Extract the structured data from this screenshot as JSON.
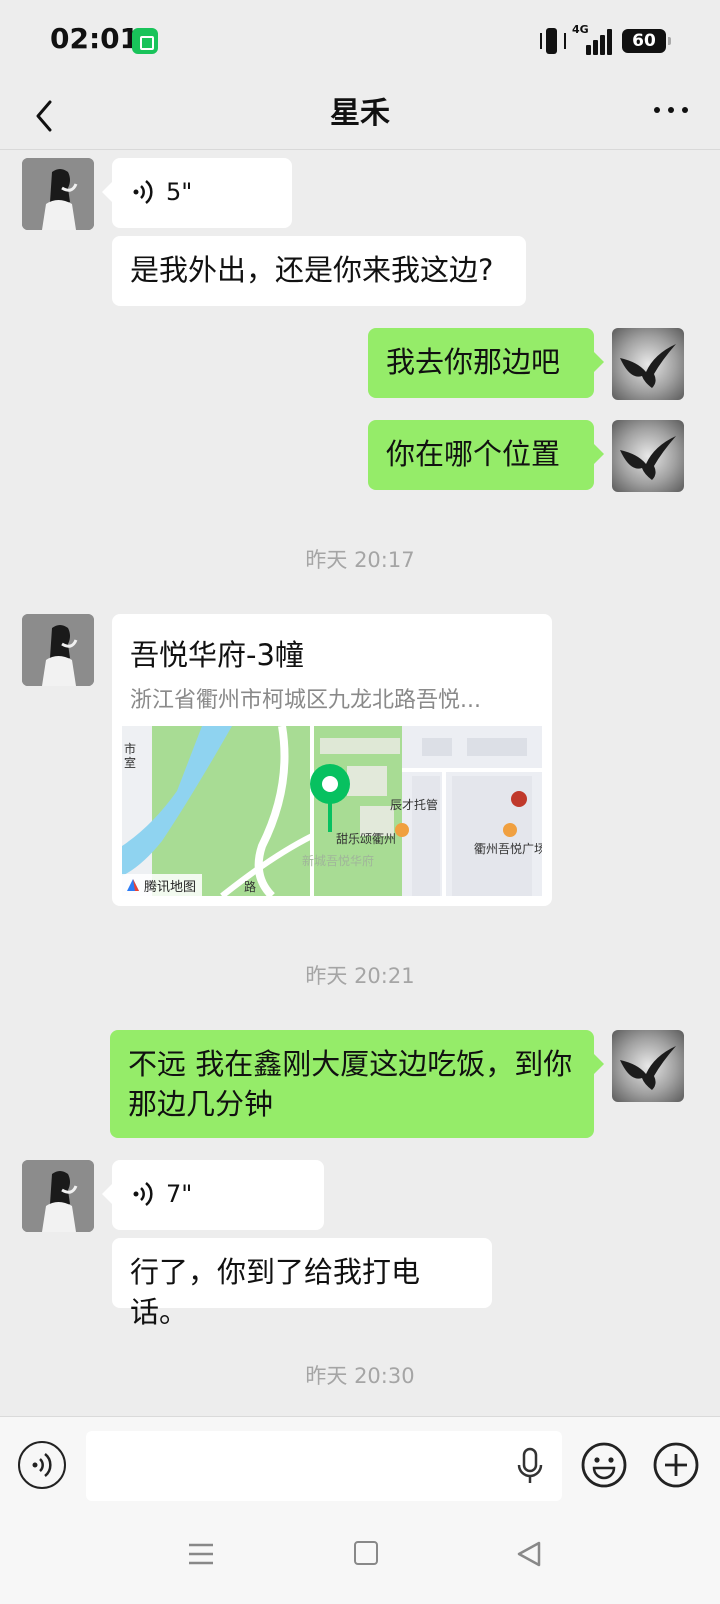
{
  "status_bar": {
    "time": "02:01",
    "network": "4G",
    "battery": "60"
  },
  "header": {
    "title": "星禾"
  },
  "messages": [
    {
      "id": "m1",
      "side": "in",
      "kind": "voice",
      "duration": "5\""
    },
    {
      "id": "m2",
      "side": "in",
      "kind": "text",
      "text": "是我外出，还是你来我这边?"
    },
    {
      "id": "m3",
      "side": "out",
      "kind": "text",
      "text": "我去你那边吧"
    },
    {
      "id": "m4",
      "side": "out",
      "kind": "text",
      "text": "你在哪个位置"
    },
    {
      "id": "t1",
      "kind": "timestamp",
      "text": "昨天 20:17"
    },
    {
      "id": "m5",
      "side": "in",
      "kind": "location",
      "name": "吾悦华府-3幢",
      "address": "浙江省衢州市柯城区九龙北路吾悦...",
      "map_labels": [
        "市",
        "室",
        "辰才托管",
        "甜乐颂衢州",
        "新城吾悦华府",
        "衢州吾悦广场",
        "路"
      ],
      "map_brand": "腾讯地图"
    },
    {
      "id": "t2",
      "kind": "timestamp",
      "text": "昨天 20:21"
    },
    {
      "id": "m6",
      "side": "out",
      "kind": "text",
      "text": "不远 我在鑫刚大厦这边吃饭，到你那边几分钟"
    },
    {
      "id": "m7",
      "side": "in",
      "kind": "voice",
      "duration": "7\""
    },
    {
      "id": "m8",
      "side": "in",
      "kind": "text",
      "text": "行了，你到了给我打电话。"
    },
    {
      "id": "t3",
      "kind": "timestamp",
      "text": "昨天 20:30"
    }
  ],
  "input_bar": {
    "value": "",
    "placeholder": ""
  },
  "colors": {
    "background": "#ededed",
    "outgoing_bubble": "#95ec69",
    "incoming_bubble": "#ffffff",
    "map_pin": "#07c160",
    "river": "#8fd3f0",
    "park": "#a8dc94"
  },
  "icons": {
    "back": "chevron-left-icon",
    "more": "more-dots-icon",
    "voice": "voice-wave-icon",
    "mic": "microphone-icon",
    "emoji": "smiley-icon",
    "plus": "plus-circle-icon",
    "map_pin": "map-pin-icon"
  }
}
